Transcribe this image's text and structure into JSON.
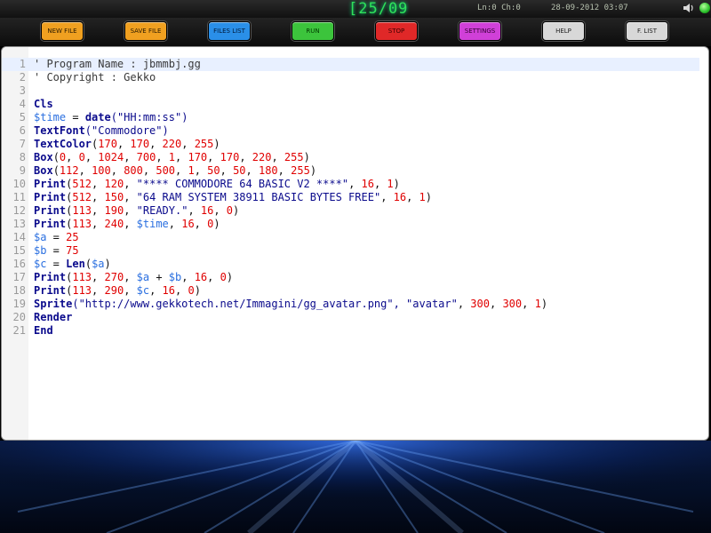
{
  "status": {
    "counter": "[25/09",
    "ln_ch": "Ln:0 Ch:0",
    "datetime": "28-09-2012 03:07"
  },
  "toolbar": {
    "buttons": [
      {
        "label": "NEW FILE",
        "color": "#f0a020",
        "text_color": "#2a1a00"
      },
      {
        "label": "SAVE FILE",
        "color": "#f0a020",
        "text_color": "#2a1a00"
      },
      {
        "label": "FILES LIST",
        "color": "#2a8fe8",
        "text_color": "#001a3a"
      },
      {
        "label": "RUN",
        "color": "#3cc43c",
        "text_color": "#003a00"
      },
      {
        "label": "STOP",
        "color": "#e02828",
        "text_color": "#3a0000"
      },
      {
        "label": "SETTINGS",
        "color": "#d040d8",
        "text_color": "#300030"
      },
      {
        "label": "HELP",
        "color": "#d8d8d8",
        "text_color": "#202020"
      },
      {
        "label": "F. LIST",
        "color": "#d8d8d8",
        "text_color": "#202020"
      }
    ]
  },
  "editor": {
    "active_line": 1,
    "lines": [
      [
        {
          "t": "' Program Name : jbmmbj.gg",
          "c": "cmt"
        }
      ],
      [
        {
          "t": "' Copyright : Gekko",
          "c": "cmt"
        }
      ],
      [],
      [
        {
          "t": "Cls",
          "c": "kw"
        }
      ],
      [
        {
          "t": "$time",
          "c": "var"
        },
        {
          "t": " = ",
          "c": "op"
        },
        {
          "t": "date",
          "c": "kw"
        },
        {
          "t": "(\"HH:mm:ss\")",
          "c": "str"
        }
      ],
      [
        {
          "t": "TextFont",
          "c": "kw"
        },
        {
          "t": "(\"Commodore\")",
          "c": "str"
        }
      ],
      [
        {
          "t": "TextColor",
          "c": "kw"
        },
        {
          "t": "(",
          "c": "op"
        },
        {
          "t": "170",
          "c": "num"
        },
        {
          "t": ", ",
          "c": "op"
        },
        {
          "t": "170",
          "c": "num"
        },
        {
          "t": ", ",
          "c": "op"
        },
        {
          "t": "220",
          "c": "num"
        },
        {
          "t": ", ",
          "c": "op"
        },
        {
          "t": "255",
          "c": "num"
        },
        {
          "t": ")",
          "c": "op"
        }
      ],
      [
        {
          "t": "Box",
          "c": "kw"
        },
        {
          "t": "(",
          "c": "op"
        },
        {
          "t": "0",
          "c": "num"
        },
        {
          "t": ", ",
          "c": "op"
        },
        {
          "t": "0",
          "c": "num"
        },
        {
          "t": ", ",
          "c": "op"
        },
        {
          "t": "1024",
          "c": "num"
        },
        {
          "t": ", ",
          "c": "op"
        },
        {
          "t": "700",
          "c": "num"
        },
        {
          "t": ", ",
          "c": "op"
        },
        {
          "t": "1",
          "c": "num"
        },
        {
          "t": ", ",
          "c": "op"
        },
        {
          "t": "170",
          "c": "num"
        },
        {
          "t": ", ",
          "c": "op"
        },
        {
          "t": "170",
          "c": "num"
        },
        {
          "t": ", ",
          "c": "op"
        },
        {
          "t": "220",
          "c": "num"
        },
        {
          "t": ", ",
          "c": "op"
        },
        {
          "t": "255",
          "c": "num"
        },
        {
          "t": ")",
          "c": "op"
        }
      ],
      [
        {
          "t": "Box",
          "c": "kw"
        },
        {
          "t": "(",
          "c": "op"
        },
        {
          "t": "112",
          "c": "num"
        },
        {
          "t": ", ",
          "c": "op"
        },
        {
          "t": "100",
          "c": "num"
        },
        {
          "t": ", ",
          "c": "op"
        },
        {
          "t": "800",
          "c": "num"
        },
        {
          "t": ", ",
          "c": "op"
        },
        {
          "t": "500",
          "c": "num"
        },
        {
          "t": ", ",
          "c": "op"
        },
        {
          "t": "1",
          "c": "num"
        },
        {
          "t": ", ",
          "c": "op"
        },
        {
          "t": "50",
          "c": "num"
        },
        {
          "t": ", ",
          "c": "op"
        },
        {
          "t": "50",
          "c": "num"
        },
        {
          "t": ", ",
          "c": "op"
        },
        {
          "t": "180",
          "c": "num"
        },
        {
          "t": ", ",
          "c": "op"
        },
        {
          "t": "255",
          "c": "num"
        },
        {
          "t": ")",
          "c": "op"
        }
      ],
      [
        {
          "t": "Print",
          "c": "kw"
        },
        {
          "t": "(",
          "c": "op"
        },
        {
          "t": "512",
          "c": "num"
        },
        {
          "t": ", ",
          "c": "op"
        },
        {
          "t": "120",
          "c": "num"
        },
        {
          "t": ", ",
          "c": "op"
        },
        {
          "t": "\"**** COMMODORE 64 BASIC V2 ****\"",
          "c": "str"
        },
        {
          "t": ", ",
          "c": "op"
        },
        {
          "t": "16",
          "c": "num"
        },
        {
          "t": ", ",
          "c": "op"
        },
        {
          "t": "1",
          "c": "num"
        },
        {
          "t": ")",
          "c": "op"
        }
      ],
      [
        {
          "t": "Print",
          "c": "kw"
        },
        {
          "t": "(",
          "c": "op"
        },
        {
          "t": "512",
          "c": "num"
        },
        {
          "t": ", ",
          "c": "op"
        },
        {
          "t": "150",
          "c": "num"
        },
        {
          "t": ", ",
          "c": "op"
        },
        {
          "t": "\"64 RAM SYSTEM 38911 BASIC BYTES FREE\"",
          "c": "str"
        },
        {
          "t": ", ",
          "c": "op"
        },
        {
          "t": "16",
          "c": "num"
        },
        {
          "t": ", ",
          "c": "op"
        },
        {
          "t": "1",
          "c": "num"
        },
        {
          "t": ")",
          "c": "op"
        }
      ],
      [
        {
          "t": "Print",
          "c": "kw"
        },
        {
          "t": "(",
          "c": "op"
        },
        {
          "t": "113",
          "c": "num"
        },
        {
          "t": ", ",
          "c": "op"
        },
        {
          "t": "190",
          "c": "num"
        },
        {
          "t": ", ",
          "c": "op"
        },
        {
          "t": "\"READY.\"",
          "c": "str"
        },
        {
          "t": ", ",
          "c": "op"
        },
        {
          "t": "16",
          "c": "num"
        },
        {
          "t": ", ",
          "c": "op"
        },
        {
          "t": "0",
          "c": "num"
        },
        {
          "t": ")",
          "c": "op"
        }
      ],
      [
        {
          "t": "Print",
          "c": "kw"
        },
        {
          "t": "(",
          "c": "op"
        },
        {
          "t": "113",
          "c": "num"
        },
        {
          "t": ", ",
          "c": "op"
        },
        {
          "t": "240",
          "c": "num"
        },
        {
          "t": ", ",
          "c": "op"
        },
        {
          "t": "$time",
          "c": "var"
        },
        {
          "t": ", ",
          "c": "op"
        },
        {
          "t": "16",
          "c": "num"
        },
        {
          "t": ", ",
          "c": "op"
        },
        {
          "t": "0",
          "c": "num"
        },
        {
          "t": ")",
          "c": "op"
        }
      ],
      [
        {
          "t": "$a",
          "c": "var"
        },
        {
          "t": " = ",
          "c": "op"
        },
        {
          "t": "25",
          "c": "num"
        }
      ],
      [
        {
          "t": "$b",
          "c": "var"
        },
        {
          "t": " = ",
          "c": "op"
        },
        {
          "t": "75",
          "c": "num"
        }
      ],
      [
        {
          "t": "$c",
          "c": "var"
        },
        {
          "t": " = ",
          "c": "op"
        },
        {
          "t": "Len",
          "c": "kw"
        },
        {
          "t": "(",
          "c": "op"
        },
        {
          "t": "$a",
          "c": "var"
        },
        {
          "t": ")",
          "c": "op"
        }
      ],
      [
        {
          "t": "Print",
          "c": "kw"
        },
        {
          "t": "(",
          "c": "op"
        },
        {
          "t": "113",
          "c": "num"
        },
        {
          "t": ", ",
          "c": "op"
        },
        {
          "t": "270",
          "c": "num"
        },
        {
          "t": ", ",
          "c": "op"
        },
        {
          "t": "$a",
          "c": "var"
        },
        {
          "t": " + ",
          "c": "op"
        },
        {
          "t": "$b",
          "c": "var"
        },
        {
          "t": ", ",
          "c": "op"
        },
        {
          "t": "16",
          "c": "num"
        },
        {
          "t": ", ",
          "c": "op"
        },
        {
          "t": "0",
          "c": "num"
        },
        {
          "t": ")",
          "c": "op"
        }
      ],
      [
        {
          "t": "Print",
          "c": "kw"
        },
        {
          "t": "(",
          "c": "op"
        },
        {
          "t": "113",
          "c": "num"
        },
        {
          "t": ", ",
          "c": "op"
        },
        {
          "t": "290",
          "c": "num"
        },
        {
          "t": ", ",
          "c": "op"
        },
        {
          "t": "$c",
          "c": "var"
        },
        {
          "t": ", ",
          "c": "op"
        },
        {
          "t": "16",
          "c": "num"
        },
        {
          "t": ", ",
          "c": "op"
        },
        {
          "t": "0",
          "c": "num"
        },
        {
          "t": ")",
          "c": "op"
        }
      ],
      [
        {
          "t": "Sprite",
          "c": "kw"
        },
        {
          "t": "(\"http://www.gekkotech.net/Immagini/gg_avatar.png\", \"avatar\"",
          "c": "str"
        },
        {
          "t": ", ",
          "c": "op"
        },
        {
          "t": "300",
          "c": "num"
        },
        {
          "t": ", ",
          "c": "op"
        },
        {
          "t": "300",
          "c": "num"
        },
        {
          "t": ", ",
          "c": "op"
        },
        {
          "t": "1",
          "c": "num"
        },
        {
          "t": ")",
          "c": "op"
        }
      ],
      [
        {
          "t": "Render",
          "c": "kw"
        }
      ],
      [
        {
          "t": "End",
          "c": "kw"
        }
      ]
    ]
  }
}
